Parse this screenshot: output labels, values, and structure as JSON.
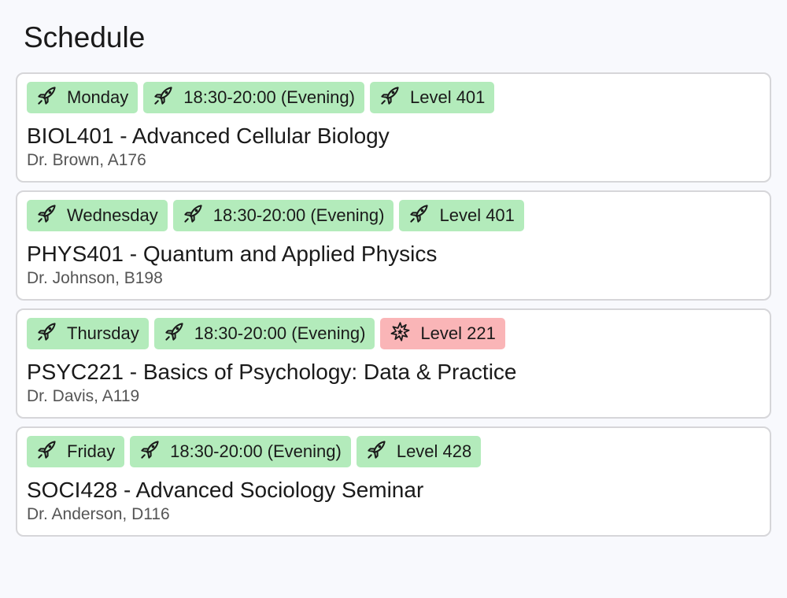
{
  "header": {
    "title": "Schedule"
  },
  "colors": {
    "tag_green": "#b3ebbb",
    "tag_red": "#fab5b7"
  },
  "courses": [
    {
      "day": "Monday",
      "time": "18:30-20:00 (Evening)",
      "level": "Level 401",
      "level_icon": "rocket-icon",
      "title": "BIOL401 - Advanced Cellular Biology",
      "meta": "Dr. Brown, A176"
    },
    {
      "day": "Wednesday",
      "time": "18:30-20:00 (Evening)",
      "level": "Level 401",
      "level_icon": "rocket-icon",
      "title": "PHYS401 - Quantum and Applied Physics",
      "meta": "Dr. Johnson, B198"
    },
    {
      "day": "Thursday",
      "time": "18:30-20:00 (Evening)",
      "level": "Level 221",
      "level_icon": "burst-icon",
      "title": "PSYC221 - Basics of Psychology: Data & Practice",
      "meta": "Dr. Davis, A119"
    },
    {
      "day": "Friday",
      "time": "18:30-20:00 (Evening)",
      "level": "Level 428",
      "level_icon": "rocket-icon",
      "title": "SOCI428 - Advanced Sociology Seminar",
      "meta": "Dr. Anderson, D116"
    }
  ]
}
